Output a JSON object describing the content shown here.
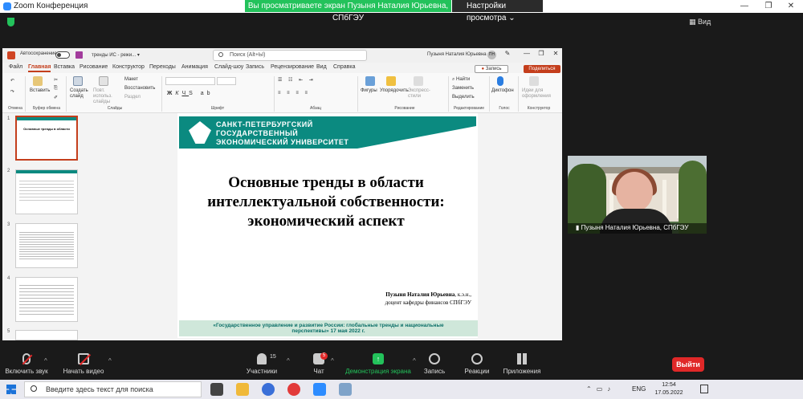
{
  "window": {
    "app_title": "Zoom Конференция",
    "share_banner": "Вы просматриваете экран Пузыня Наталия Юрьевна, СПбГЭУ",
    "view_options": "Настройки просмотра",
    "view_label": "Вид"
  },
  "ppt": {
    "autosave": "Автосохранение",
    "doc_name": "тренды ИС  -  режи... ▾",
    "search_placeholder": "Поиск (Alt+Ы)",
    "user_name": "Пузыня Наталия Юрьевна",
    "user_initials": "ПН",
    "menu": [
      "Файл",
      "Главная",
      "Вставка",
      "Рисование",
      "Конструктор",
      "Переходы",
      "Анимация",
      "Слайд-шоу",
      "Запись",
      "Рецензирование",
      "Вид",
      "Справка"
    ],
    "record_label": "Запись",
    "share_label": "Поделиться",
    "ribbon": {
      "groups": [
        "Отмена",
        "Буфер обмена",
        "Слайды",
        "Шрифт",
        "Абзац",
        "Рисование",
        "Редактирование",
        "Голос",
        "Конструктор"
      ],
      "paste": "Вставить",
      "new_slide": "Создать слайд",
      "reuse": "Повт. использ. слайды",
      "layout": "Макет",
      "reset": "Восстановить",
      "section": "Раздел",
      "shapes": "Фигуры",
      "arrange": "Упорядочить",
      "quick_styles": "Экспресс-стили",
      "find": "Найти",
      "replace": "Заменить",
      "select": "Выделить",
      "dictate": "Диктофон",
      "designer": "Идеи для оформления"
    }
  },
  "thumbs": [
    "1",
    "2",
    "3",
    "4",
    "5"
  ],
  "slide": {
    "org_lines": [
      "САНКТ-ПЕТЕРБУРГСКИЙ",
      "ГОСУДАРСТВЕННЫЙ",
      "ЭКОНОМИЧЕСКИЙ УНИВЕРСИТЕТ"
    ],
    "title_lines": [
      "Основные тренды в области",
      "интеллектуальной собственности:",
      "экономический аспект"
    ],
    "author_name": "Пузыня Наталия Юрьевна",
    "author_suffix": ", к.э.н.,",
    "author_role": "доцент кафедры финансов СПбГЭУ",
    "footer": "«Государственное управление и развитие России: глобальные тренды и национальные перспективы» 17 мая 2022 г."
  },
  "webcam": {
    "name": "Пузыня Наталия Юрьевна, СПбГЭУ"
  },
  "toolbar": {
    "audio": "Включить звук",
    "video": "Начать видео",
    "participants": "Участники",
    "participants_count": "15",
    "chat": "Чат",
    "chat_count": "5",
    "share": "Демонстрация экрана",
    "record": "Запись",
    "reactions": "Реакции",
    "apps": "Приложения",
    "exit": "Выйти"
  },
  "taskbar": {
    "search": "Введите здесь текст для поиска",
    "lang": "ENG",
    "time": "12:54",
    "date": "17.05.2022"
  },
  "colors": {
    "accent": "#c43e1c",
    "teal": "#0b8a80",
    "zoom_green": "#23c25b",
    "exit_red": "#e02828"
  }
}
